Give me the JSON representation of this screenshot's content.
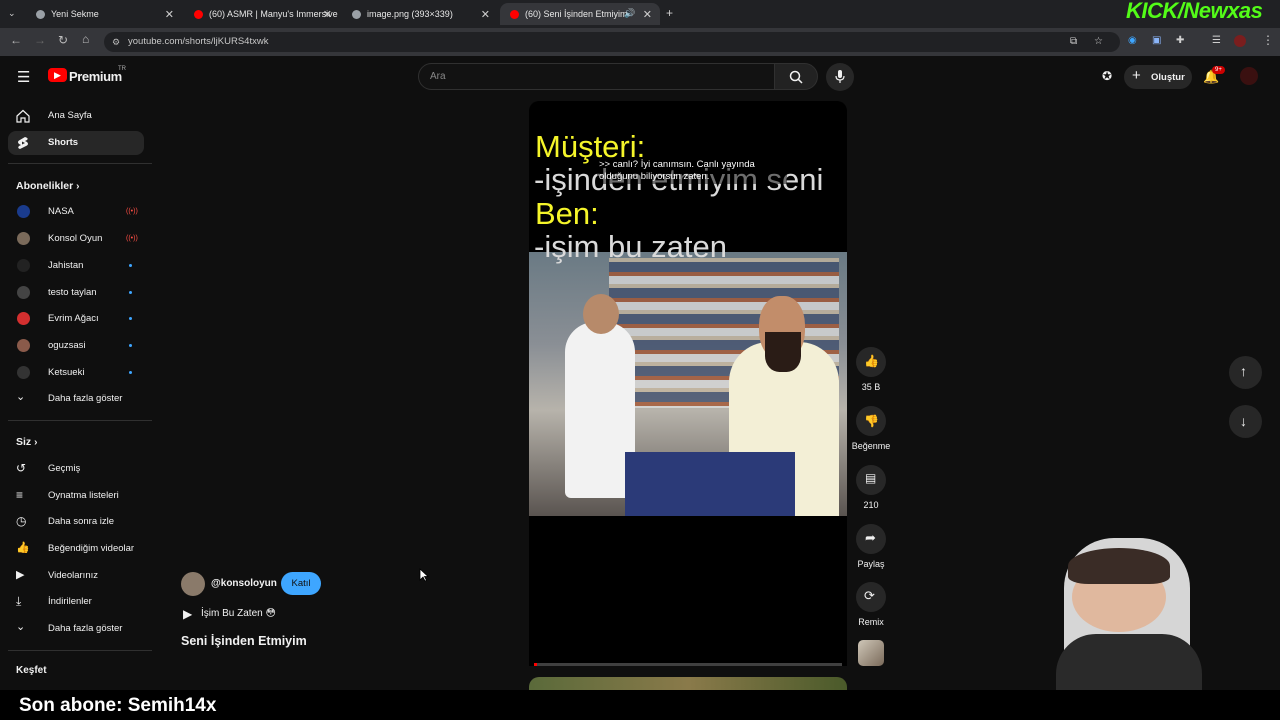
{
  "browser": {
    "tabs": [
      {
        "title": "Yeni Sekme",
        "favicon_color": "#9aa0a6"
      },
      {
        "title": "(60) ASMR | Manyu's Immersive",
        "favicon_color": "#ff0000"
      },
      {
        "title": "image.png (393×339)",
        "favicon_color": "#9aa0a6"
      },
      {
        "title": "(60) Seni İşinden Etmiyim -",
        "favicon_color": "#ff0000"
      }
    ],
    "new_tab": "+",
    "url": "youtube.com/shorts/ljKURS4txwk"
  },
  "header": {
    "logo": "Premium",
    "region": "TR",
    "search_placeholder": "Ara",
    "create_label": "Oluştur",
    "notif_badge": "9+"
  },
  "sidebar": {
    "top": [
      {
        "label": "Ana Sayfa",
        "icon": "home-icon"
      },
      {
        "label": "Shorts",
        "icon": "shorts-icon"
      }
    ],
    "subs_title": "Abonelikler",
    "subs": [
      {
        "label": "NASA",
        "color": "#1a3b8c",
        "status": "live"
      },
      {
        "label": "Konsol Oyun",
        "color": "#7a6a5a",
        "status": "live"
      },
      {
        "label": "Jahistan",
        "color": "#222222",
        "status": "dot"
      },
      {
        "label": "testo taylan",
        "color": "#444444",
        "status": "dot"
      },
      {
        "label": "Evrim Ağacı",
        "color": "#d32f2f",
        "status": "dot"
      },
      {
        "label": "oguzsasi",
        "color": "#8a5a4a",
        "status": "dot"
      },
      {
        "label": "Ketsueki",
        "color": "#333333",
        "status": "dot"
      }
    ],
    "subs_more": "Daha fazla göster",
    "you_title": "Siz",
    "you": [
      {
        "label": "Geçmiş",
        "icon": "history-icon"
      },
      {
        "label": "Oynatma listeleri",
        "icon": "playlist-icon"
      },
      {
        "label": "Daha sonra izle",
        "icon": "clock-icon"
      },
      {
        "label": "Beğendiğim videolar",
        "icon": "like-icon"
      },
      {
        "label": "Videolarınız",
        "icon": "video-icon"
      },
      {
        "label": "İndirilenler",
        "icon": "download-icon"
      },
      {
        "label": "Daha fazla göster",
        "icon": "chevron-down-icon"
      }
    ],
    "explore_title": "Keşfet"
  },
  "video": {
    "overlay_line1": "Müşteri:",
    "overlay_line2": "-işinden etmiyim seni",
    "overlay_line3": "Ben:",
    "overlay_line4": "-işim bu zaten",
    "caption": ">> canlı? İyi canımsın. Canlı yayında olduğunu biliyorsun zaten.",
    "progress": 0.01
  },
  "channel": {
    "handle": "@konsoloyun",
    "join_label": "Katıl",
    "sound": "İşim Bu Zaten 😳",
    "title": "Seni İşinden Etmiyim"
  },
  "actions": {
    "likes": "35 B",
    "dislike_label": "Beğenme",
    "comments": "210",
    "share_label": "Paylaş",
    "remix_label": "Remix"
  },
  "stream": {
    "brand": "KICK/Newxas",
    "last_sub": "Son abone: Semih14x"
  },
  "colors": {
    "overlay_yellow": "#f5f52a",
    "overlay_white": "#e0e0e0",
    "join_blue": "#3ea6ff",
    "kick_green": "#53fc18",
    "yt_red": "#ff0000"
  }
}
